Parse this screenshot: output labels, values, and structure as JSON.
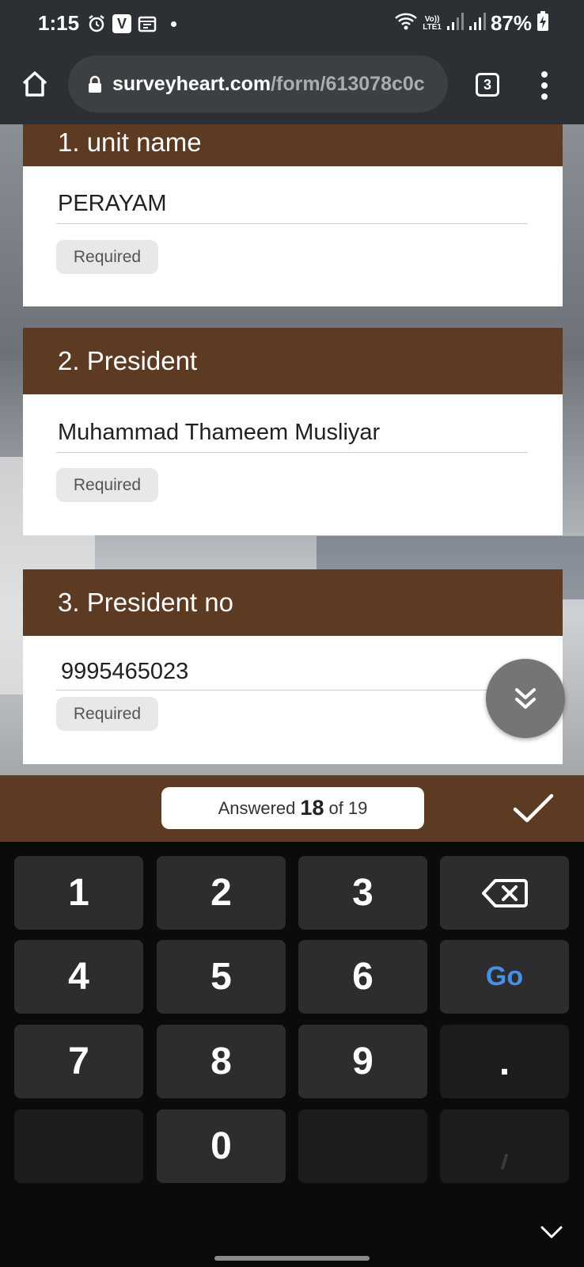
{
  "status_bar": {
    "time": "1:15",
    "lte": "Vo))\nLTE1",
    "battery": "87%"
  },
  "browser": {
    "url_host": "surveyheart.com",
    "url_path": "/form/613078c0c",
    "tab_count": "3"
  },
  "form": {
    "questions": [
      {
        "title": "1. unit name",
        "value": "PERAYAM",
        "required_label": "Required"
      },
      {
        "title": "2. President",
        "value": "Muhammad Thameem Musliyar",
        "required_label": "Required"
      },
      {
        "title": "3. President no",
        "value": "9995465023",
        "required_label": "Required"
      }
    ]
  },
  "progress": {
    "prefix": "Answered",
    "answered": "18",
    "suffix": "of 19"
  },
  "keyboard": {
    "keys": [
      "1",
      "2",
      "3",
      "4",
      "5",
      "6",
      "Go",
      "7",
      "8",
      "9",
      ".",
      "0"
    ]
  },
  "colors": {
    "form_header": "#5d3a22",
    "browser_chrome": "#2c2f33",
    "go_key": "#4a90e2"
  }
}
